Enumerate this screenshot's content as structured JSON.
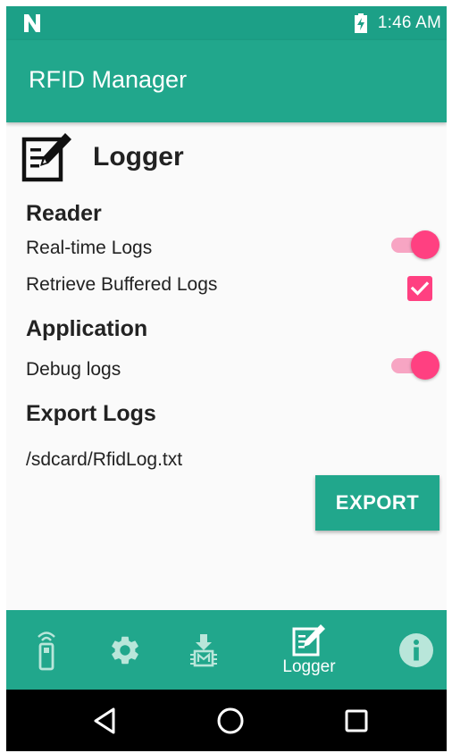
{
  "status_bar": {
    "left_icon": "n-notification-icon",
    "battery_icon": "battery-charging-icon",
    "time": "1:46 AM"
  },
  "app_bar": {
    "title": "RFID Manager"
  },
  "page": {
    "icon": "logger-edit-icon",
    "title": "Logger"
  },
  "reader": {
    "heading": "Reader",
    "realtime_label": "Real-time Logs",
    "realtime_on": true,
    "buffered_label": "Retrieve Buffered Logs",
    "buffered_checked": true
  },
  "application": {
    "heading": "Application",
    "debug_label": "Debug logs",
    "debug_on": true
  },
  "export": {
    "heading": "Export Logs",
    "path": "/sdcard/RfidLog.txt",
    "button_label": "EXPORT"
  },
  "bottom_nav": {
    "items": [
      {
        "icon": "rfid-reader-icon",
        "label": ""
      },
      {
        "icon": "gear-icon",
        "label": ""
      },
      {
        "icon": "download-chip-icon",
        "label": ""
      },
      {
        "icon": "logger-edit-icon",
        "label": "Logger"
      },
      {
        "icon": "info-icon",
        "label": ""
      }
    ],
    "active_index": 3
  },
  "system_nav": {
    "icons": [
      "back-icon",
      "home-icon",
      "recents-icon"
    ]
  },
  "colors": {
    "primary": "#21a78c",
    "status_bar": "#1ca087",
    "accent": "#ff4081",
    "accent_track": "#f7a5c3",
    "text": "#222222",
    "background": "#fafafa"
  }
}
